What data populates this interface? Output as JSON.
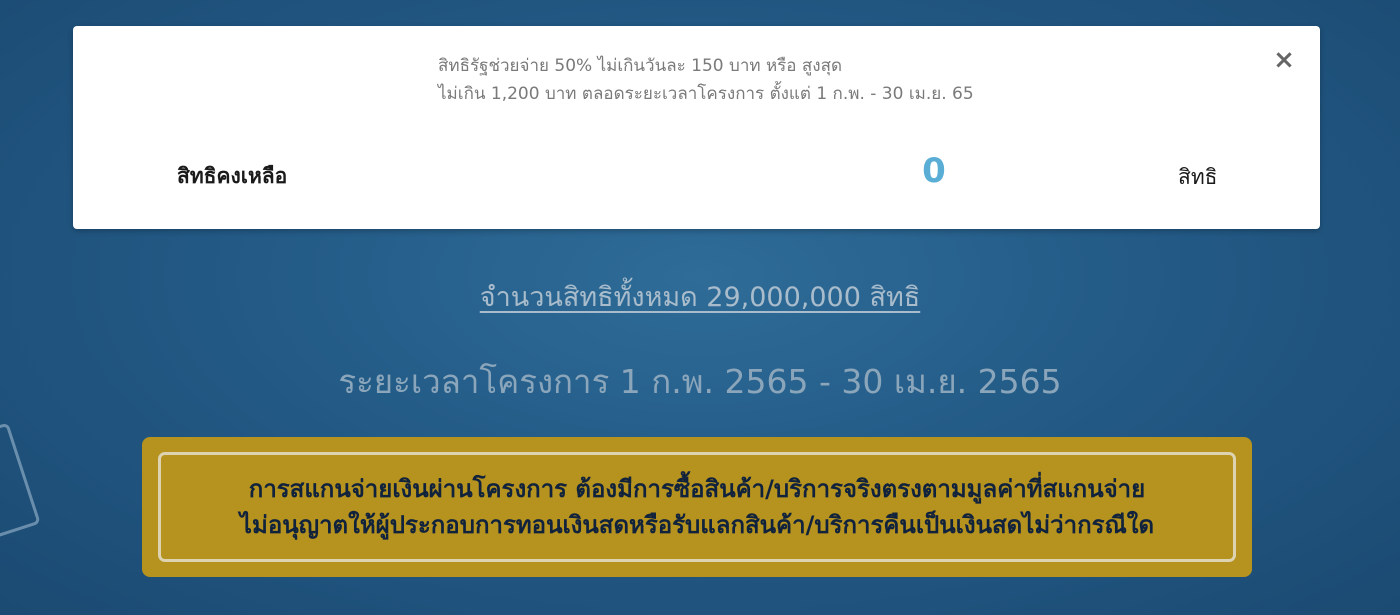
{
  "card": {
    "info_line1": "สิทธิรัฐช่วยจ่าย 50% ไม่เกินวันละ 150 บาท หรือ สูงสุด",
    "info_line2": "ไม่เกิน 1,200 บาท ตลอดระยะเวลาโครงการ ตั้งแต่ 1 ก.พ. - 30 เม.ย. 65",
    "close_label": "×",
    "remaining_label": "สิทธิคงเหลือ",
    "remaining_value": "0",
    "remaining_unit": "สิทธิ"
  },
  "total_rights": "จำนวนสิทธิทั้งหมด 29,000,000 สิทธิ",
  "period": "ระยะเวลาโครงการ 1 ก.พ. 2565 - 30 เม.ย. 2565",
  "notice": {
    "line1": "การสแกนจ่ายเงินผ่านโครงการ ต้องมีการซื้อสินค้า/บริการจริงตรงตามมูลค่าที่สแกนจ่าย",
    "line2": "ไม่อนุญาตให้ผู้ประกอบการทอนเงินสดหรือรับแลกสินค้า/บริการคืนเป็นเงินสดไม่ว่ากรณีใด"
  },
  "colors": {
    "background": "#235a86",
    "accent_value": "#5aaed6",
    "notice_bg": "#b6921e",
    "notice_text": "#11233c"
  }
}
